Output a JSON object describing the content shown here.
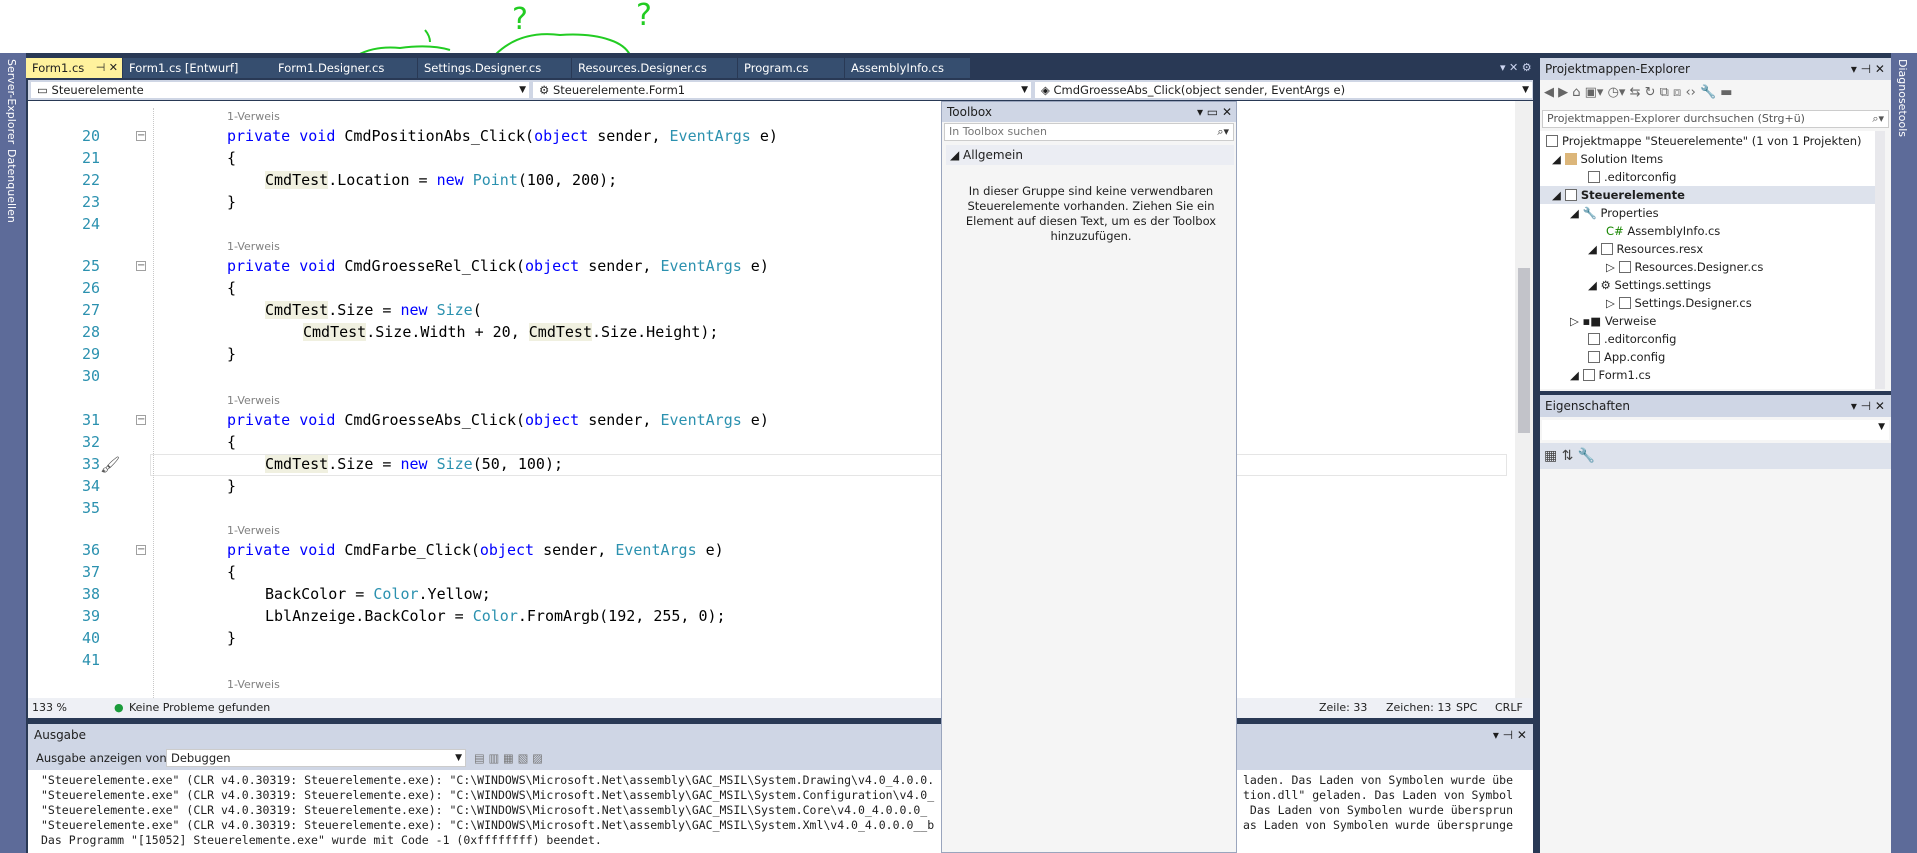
{
  "tabs": [
    {
      "label": "Form1.cs",
      "active": true
    },
    {
      "label": "Form1.cs [Entwurf]"
    },
    {
      "label": "Form1.Designer.cs"
    },
    {
      "label": "Settings.Designer.cs"
    },
    {
      "label": "Resources.Designer.cs"
    },
    {
      "label": "Program.cs"
    },
    {
      "label": "AssemblyInfo.cs"
    }
  ],
  "left_rail": {
    "server_explorer": "Server-Explorer",
    "data_sources": "Datenquellen"
  },
  "right_rail": {
    "diagnostics": "Diagnosetools"
  },
  "nav": {
    "project": "Steuerelemente",
    "class": "Steuerelemente.Form1",
    "member": "CmdGroesseAbs_Click(object sender, EventArgs e)"
  },
  "code": {
    "ref_label": "1-Verweis",
    "line_numbers": [
      "20",
      "21",
      "22",
      "23",
      "24",
      "25",
      "26",
      "27",
      "28",
      "29",
      "30",
      "31",
      "32",
      "33",
      "34",
      "35",
      "36",
      "37",
      "38",
      "39",
      "40",
      "41"
    ]
  },
  "editor_status": {
    "zoom": "133 %",
    "issues": "Keine Probleme gefunden",
    "line": "Zeile: 33",
    "col": "Zeichen: 13",
    "spc": "SPC",
    "crlf": "CRLF"
  },
  "output": {
    "title": "Ausgabe",
    "show_label": "Ausgabe anzeigen von:",
    "source": "Debuggen",
    "lines": [
      "\"Steuerelemente.exe\" (CLR v4.0.30319: Steuerelemente.exe): \"C:\\WINDOWS\\Microsoft.Net\\assembly\\GAC_MSIL\\System.Drawing\\v4.0_4.0.0.",
      "\"Steuerelemente.exe\" (CLR v4.0.30319: Steuerelemente.exe): \"C:\\WINDOWS\\Microsoft.Net\\assembly\\GAC_MSIL\\System.Configuration\\v4.0_",
      "\"Steuerelemente.exe\" (CLR v4.0.30319: Steuerelemente.exe): \"C:\\WINDOWS\\Microsoft.Net\\assembly\\GAC_MSIL\\System.Core\\v4.0_4.0.0.0_",
      "\"Steuerelemente.exe\" (CLR v4.0.30319: Steuerelemente.exe): \"C:\\WINDOWS\\Microsoft.Net\\assembly\\GAC_MSIL\\System.Xml\\v4.0_4.0.0.0__b",
      "Das Programm \"[15052] Steuerelemente.exe\" wurde mit Code -1 (0xffffffff) beendet."
    ],
    "tail_lines": [
      "laden. Das Laden von Symbolen wurde übe",
      "tion.dll\" geladen. Das Laden von Symbol",
      " Das Laden von Symbolen wurde übersprun",
      "as Laden von Symbolen wurde übersprunge",
      ""
    ]
  },
  "toolbox": {
    "title": "Toolbox",
    "search_placeholder": "In Toolbox suchen",
    "group": "Allgemein",
    "empty_text": "In dieser Gruppe sind keine verwendbaren Steuerelemente vorhanden. Ziehen Sie ein Element auf diesen Text, um es der Toolbox hinzuzufügen."
  },
  "solution_explorer": {
    "title": "Projektmappen-Explorer",
    "search_placeholder": "Projektmappen-Explorer durchsuchen (Strg+ü)",
    "items": [
      {
        "label": "Projektmappe \"Steuerelemente\" (1 von 1 Projekten)"
      },
      {
        "label": "Solution Items"
      },
      {
        "label": ".editorconfig"
      },
      {
        "label": "Steuerelemente"
      },
      {
        "label": "Properties"
      },
      {
        "label": "AssemblyInfo.cs"
      },
      {
        "label": "Resources.resx"
      },
      {
        "label": "Resources.Designer.cs"
      },
      {
        "label": "Settings.settings"
      },
      {
        "label": "Settings.Designer.cs"
      },
      {
        "label": "Verweise"
      },
      {
        "label": ".editorconfig"
      },
      {
        "label": "App.config"
      },
      {
        "label": "Form1.cs"
      }
    ]
  },
  "properties": {
    "title": "Eigenschaften"
  },
  "annotations": {
    "q1": "?",
    "q2": "?"
  }
}
